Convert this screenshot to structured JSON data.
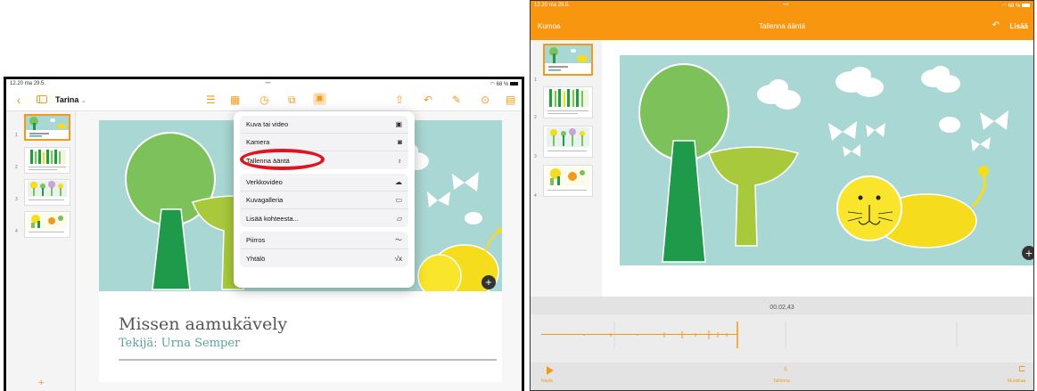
{
  "left": {
    "status": {
      "time": "12.20",
      "date": "ma 29.5.",
      "battery": "68 %"
    },
    "toolbar": {
      "doc_title": "Tarina"
    },
    "slides": [
      "1",
      "2",
      "3",
      "4"
    ],
    "slide": {
      "title": "Missen aamukävely",
      "subtitle": "Tekijä: Urna Semper"
    },
    "menu": {
      "group1": [
        "Kuva tai video",
        "Kamera",
        "Tallenna ääntä"
      ],
      "group2": [
        "Verkkovideo",
        "Kuvagalleria",
        "Lisää kohteesta..."
      ],
      "group3": [
        "Piirros",
        "Yhtälö"
      ]
    },
    "add_label": "+"
  },
  "right": {
    "status": {
      "time": "12.20",
      "date": "ma 29.5.",
      "battery": "68 %"
    },
    "header": {
      "undo": "Kumoa",
      "title": "Tallenna ääntä",
      "done": "Lisää"
    },
    "slides": [
      "1",
      "2",
      "3",
      "4"
    ],
    "recording": {
      "time": "00.02,43"
    },
    "bottom": {
      "play": "Näyte",
      "record": "Tallenna",
      "edit": "Muokkaa"
    }
  },
  "colors": {
    "accent": "#f9960f",
    "highlight": "#e0141e",
    "slide_bg": "#a9d7d3",
    "title": "#555555",
    "subtitle": "#5aa39e"
  },
  "icons": [
    "back-icon",
    "sidebar-icon",
    "list-icon",
    "table-icon",
    "chart-icon",
    "shapes-icon",
    "media-icon",
    "share-icon",
    "undo-icon",
    "brush-icon",
    "more-icon",
    "doc-icon",
    "photo-icon",
    "camera-icon",
    "mic-icon",
    "web-video-icon",
    "gallery-icon",
    "folder-icon",
    "draw-icon",
    "equation-icon",
    "play-icon",
    "trim-icon"
  ]
}
